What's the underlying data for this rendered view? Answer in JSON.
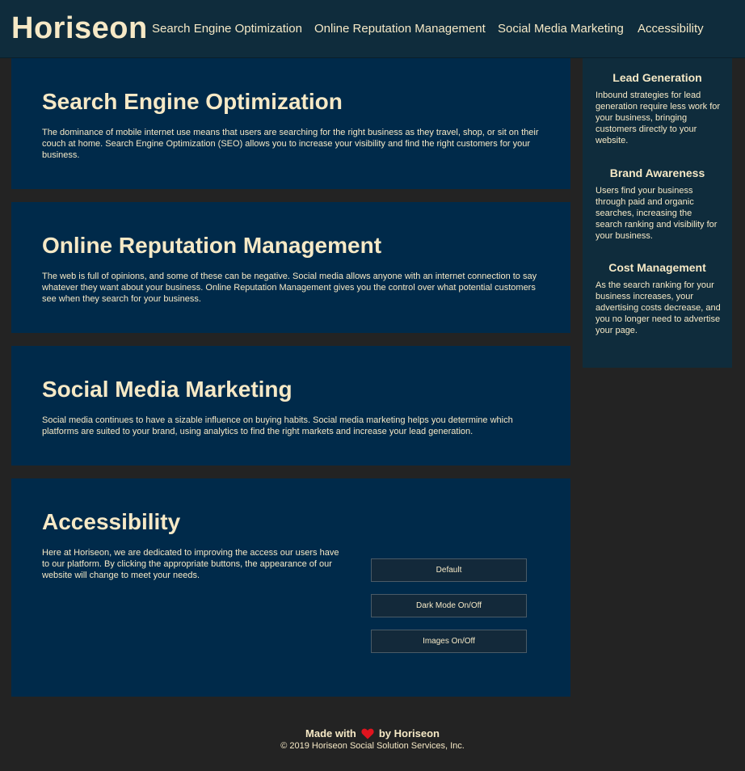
{
  "header": {
    "logo": "Horiseon",
    "nav": [
      {
        "label": "Search Engine Optimization"
      },
      {
        "label": "Online Reputation Management"
      },
      {
        "label": "Social Media Marketing"
      },
      {
        "label": "Accessibility"
      }
    ]
  },
  "sections": [
    {
      "title": "Search Engine Optimization",
      "body": "The dominance of mobile internet use means that users are searching for the right business as they travel, shop, or sit on their couch at home. Search Engine Optimization (SEO) allows you to increase your visibility and find the right customers for your business."
    },
    {
      "title": "Online Reputation Management",
      "body": "The web is full of opinions, and some of these can be negative. Social media allows anyone with an internet connection to say whatever they want about your business. Online Reputation Management gives you the control over what potential customers see when they search for your business."
    },
    {
      "title": "Social Media Marketing",
      "body": "Social media continues to have a sizable influence on buying habits. Social media marketing helps you determine which platforms are suited to your brand, using analytics to find the right markets and increase your lead generation."
    },
    {
      "title": "Accessibility",
      "body": "Here at Horiseon, we are dedicated to improving the access our users have to our platform. By clicking the appropriate buttons, the appearance of our website will change to meet your needs.",
      "buttons": [
        {
          "label": "Default"
        },
        {
          "label": "Dark Mode On/Off"
        },
        {
          "label": "Images On/Off"
        }
      ]
    }
  ],
  "aside": [
    {
      "title": "Lead Generation",
      "body": "Inbound strategies for lead generation require less work for your business, bringing customers directly to your website."
    },
    {
      "title": "Brand Awareness",
      "body": "Users find your business through paid and organic searches, increasing the search ranking and visibility for your business."
    },
    {
      "title": "Cost Management",
      "body": "As the search ranking for your business increases, your advertising costs decrease, and you no longer need to advertise your page."
    }
  ],
  "footer": {
    "made_prefix": "Made with",
    "heart_icon": "heart-icon",
    "made_suffix": "by Horiseon",
    "copyright": "© 2019 Horiseon Social Solution Services, Inc."
  },
  "colors": {
    "page_bg": "#232323",
    "header_bg": "#0f2c3c",
    "section_bg": "#002a4a",
    "text": "#f6e9c6",
    "heart": "#e0141e"
  }
}
